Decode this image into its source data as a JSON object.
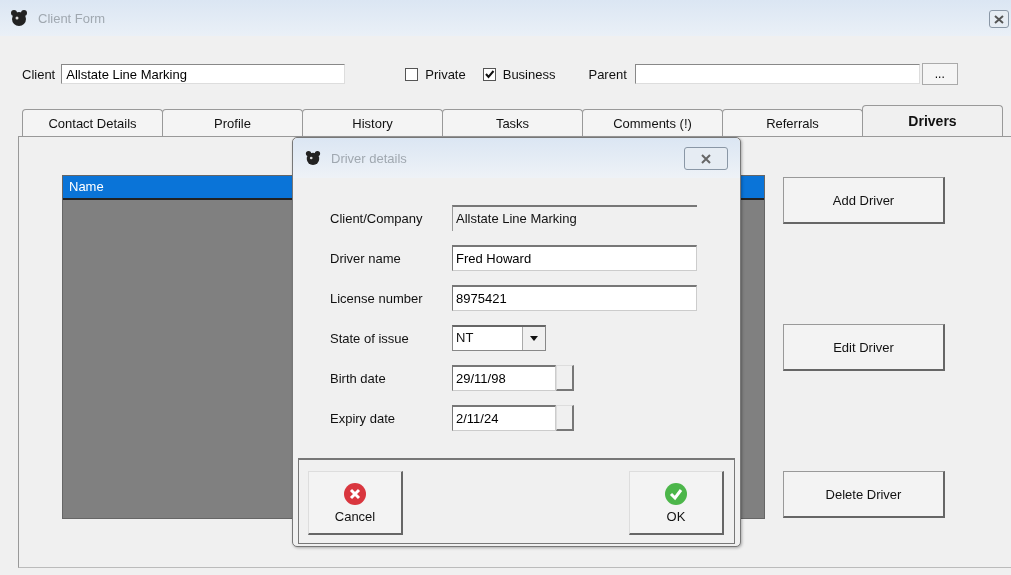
{
  "window": {
    "title": "Client Form"
  },
  "client_row": {
    "client_label": "Client",
    "client_value": "Allstate Line Marking",
    "checkboxes": [
      {
        "label": "Private",
        "checked": false
      },
      {
        "label": "Business",
        "checked": true
      }
    ],
    "parent_label": "Parent",
    "browse_button": "..."
  },
  "tabs": [
    {
      "label": "Contact Details",
      "selected": false
    },
    {
      "label": "Profile",
      "selected": false
    },
    {
      "label": "History",
      "selected": false
    },
    {
      "label": "Tasks",
      "selected": false
    },
    {
      "label": "Comments (!)",
      "selected": false
    },
    {
      "label": "Referrals",
      "selected": false
    },
    {
      "label": "Drivers",
      "selected": true
    }
  ],
  "drivers_list": {
    "columns": [
      "Name"
    ]
  },
  "side_buttons": [
    "Add Driver",
    "Edit Driver",
    "Delete Driver"
  ],
  "dialog": {
    "title": "Driver details",
    "fields": [
      {
        "label": "Client/Company",
        "value": "Allstate Line Marking",
        "kind": "readonly"
      },
      {
        "label": "Driver name",
        "value": "Fred Howard",
        "kind": "text"
      },
      {
        "label": "License number",
        "value": "8975421",
        "kind": "text"
      },
      {
        "label": "State of issue",
        "value": "NT",
        "kind": "dropdown"
      },
      {
        "label": "Birth date",
        "value": "29/11/98",
        "kind": "date"
      },
      {
        "label": "Expiry date",
        "value": "2/11/24",
        "kind": "date"
      }
    ],
    "buttons": [
      {
        "label": "Cancel",
        "kind": "cancel"
      },
      {
        "label": "OK",
        "kind": "ok"
      }
    ]
  }
}
